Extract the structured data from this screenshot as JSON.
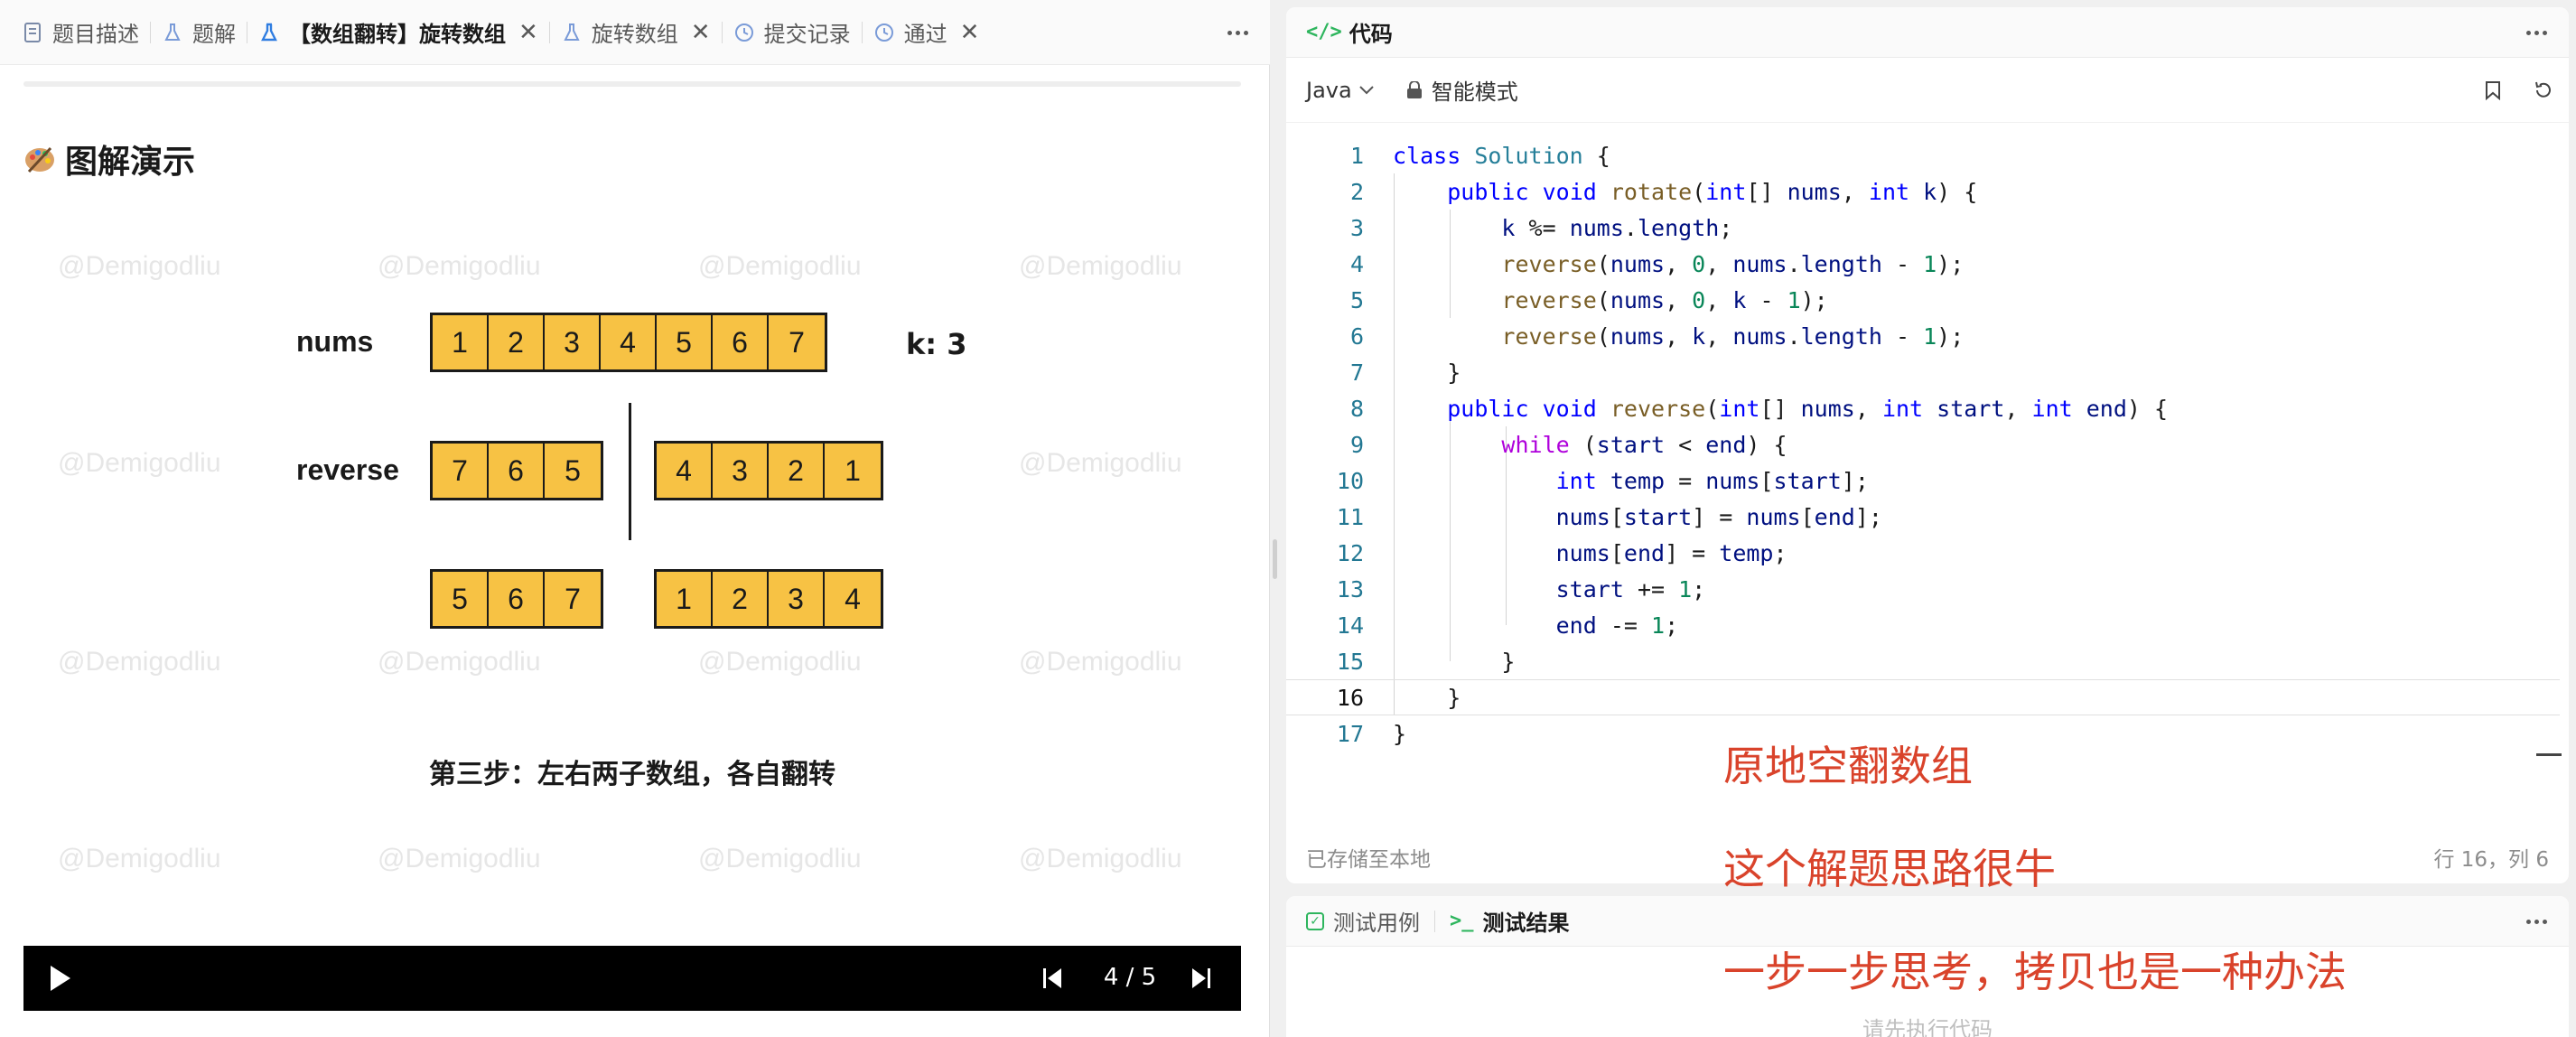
{
  "left_tabs": {
    "items": [
      {
        "label": "题目描述",
        "icon": "document-icon",
        "closable": false,
        "active": false
      },
      {
        "label": "题解",
        "icon": "flask-icon",
        "closable": false,
        "active": false
      },
      {
        "label": "【数组翻转】旋转数组",
        "icon": "flask-icon",
        "closable": true,
        "active": true
      },
      {
        "label": "旋转数组",
        "icon": "flask-icon",
        "closable": true,
        "active": false
      },
      {
        "label": "提交记录",
        "icon": "history-icon",
        "closable": false,
        "active": false
      },
      {
        "label": "通过",
        "icon": "history-icon",
        "closable": true,
        "active": false
      }
    ]
  },
  "solution": {
    "heading": "图解演示",
    "watermark": "@Demigodliu",
    "slide": {
      "nums_label": "nums",
      "nums": [
        "1",
        "2",
        "3",
        "4",
        "5",
        "6",
        "7"
      ],
      "k_label": "k: 3",
      "reverse_label": "reverse",
      "reverse_left": [
        "7",
        "6",
        "5"
      ],
      "reverse_right": [
        "4",
        "3",
        "2",
        "1"
      ],
      "result_left": [
        "5",
        "6",
        "7"
      ],
      "result_right": [
        "1",
        "2",
        "3",
        "4"
      ],
      "caption": "第三步：左右两子数组，各自翻转"
    },
    "player": {
      "counter": "4 / 5"
    }
  },
  "code_panel": {
    "title": "代码",
    "language": "Java",
    "mode": "智能模式",
    "current_line": 16,
    "lines": [
      "class Solution {",
      "    public void rotate(int[] nums, int k) {",
      "        k %= nums.length;",
      "        reverse(nums, 0, nums.length - 1);",
      "        reverse(nums, 0, k - 1);",
      "        reverse(nums, k, nums.length - 1);",
      "    }",
      "    public void reverse(int[] nums, int start, int end) {",
      "        while (start < end) {",
      "            int temp = nums[start];",
      "            nums[start] = nums[end];",
      "            nums[end] = temp;",
      "            start += 1;",
      "            end -= 1;",
      "        }",
      "    }",
      "}"
    ],
    "status_left": "已存储至本地",
    "status_right": "行 16，列 6"
  },
  "notes": [
    "原地空翻数组",
    "这个解题思路很牛",
    "一步一步思考，拷贝也是一种办法"
  ],
  "test_panel": {
    "tabs": [
      {
        "label": "测试用例",
        "icon": "checkbox-icon",
        "active": false
      },
      {
        "label": "测试结果",
        "icon": "terminal-icon",
        "active": true
      }
    ],
    "placeholder": "请先执行代码"
  },
  "colors": {
    "accent_green": "#2db55d",
    "cell_fill": "#f7c244",
    "note_red": "#d9432b"
  }
}
